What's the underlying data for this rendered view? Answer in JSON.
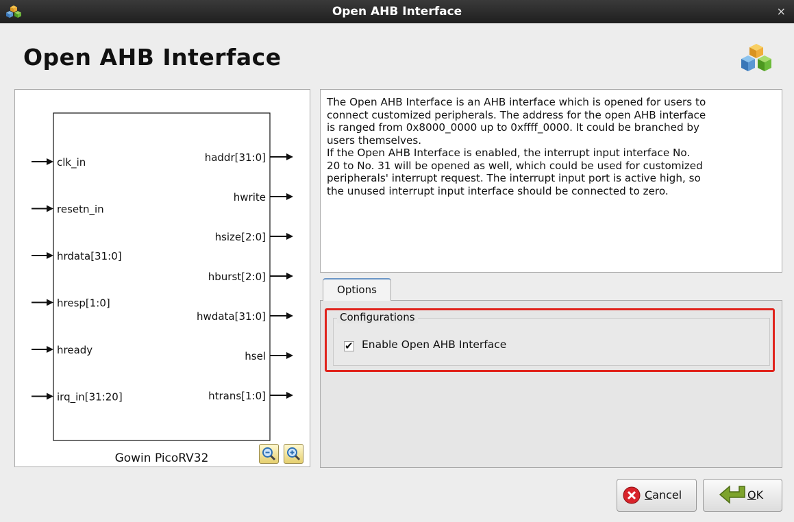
{
  "window": {
    "title": "Open AHB Interface",
    "close_glyph": "×",
    "app_icon": "cubes-icon"
  },
  "header": {
    "title": "Open AHB Interface",
    "logo": "cubes-logo-icon"
  },
  "diagram": {
    "block_name": "Gowin PicoRV32",
    "inputs": [
      "clk_in",
      "resetn_in",
      "hrdata[31:0]",
      "hresp[1:0]",
      "hready",
      "irq_in[31:20]"
    ],
    "outputs": [
      "haddr[31:0]",
      "hwrite",
      "hsize[2:0]",
      "hburst[2:0]",
      "hwdata[31:0]",
      "hsel",
      "htrans[1:0]"
    ],
    "zoom_out_icon": "zoom-out-icon",
    "zoom_in_icon": "zoom-in-icon"
  },
  "description": {
    "text": "The Open AHB Interface is an AHB interface which is opened for users to\nconnect customized peripherals. The address for the open AHB interface\nis ranged from 0x8000_0000 up to 0xffff_0000. It could be branched by\nusers themselves.\nIf the Open AHB Interface is enabled, the interrupt input interface No.\n20 to No. 31 will be opened as well, which could be used for customized\nperipherals' interrupt request. The interrupt input port is active high, so\nthe unused interrupt input interface should be connected to zero."
  },
  "tabs": [
    {
      "label": "Options"
    }
  ],
  "options": {
    "group_title": "Configurations",
    "enable_label": "Enable Open AHB Interface",
    "enable_checked": true,
    "check_glyph": "✔"
  },
  "buttons": {
    "cancel": {
      "label_first": "C",
      "label_rest": "ancel",
      "icon": "cancel-x-icon"
    },
    "ok": {
      "label_first": "O",
      "label_rest": "K",
      "icon": "ok-arrow-icon"
    }
  },
  "colors": {
    "highlight": "#e0231c",
    "tab_accent": "#6a95c6"
  }
}
